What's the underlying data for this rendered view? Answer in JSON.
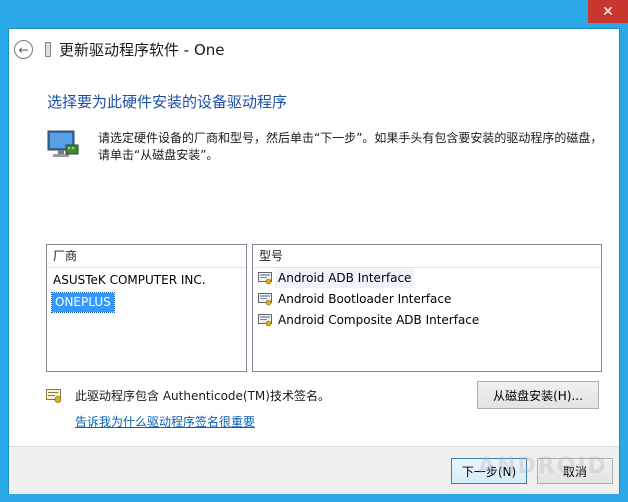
{
  "window": {
    "title": "更新驱动程序软件 - One",
    "close_glyph": "✕",
    "back_glyph": "←"
  },
  "heading": "选择要为此硬件安装的设备驱动程序",
  "description": "请选定硬件设备的厂商和型号，然后单击“下一步”。如果手头有包含要安装的驱动程序的磁盘，请单击“从磁盘安装”。",
  "manufacturers": {
    "header": "厂商",
    "items": [
      {
        "label": "ASUSTeK COMPUTER INC.",
        "selected": false
      },
      {
        "label": "ONEPLUS",
        "selected": true
      }
    ]
  },
  "models": {
    "header": "型号",
    "items": [
      {
        "label": "Android ADB Interface",
        "highlighted": true
      },
      {
        "label": "Android Bootloader Interface",
        "highlighted": false
      },
      {
        "label": "Android Composite ADB Interface",
        "highlighted": false
      }
    ]
  },
  "signature": {
    "text": "此驱动程序包含 Authenticode(TM)技术签名。",
    "link": "告诉我为什么驱动程序签名很重要"
  },
  "buttons": {
    "have_disk": "从磁盘安装(H)...",
    "next": "下一步(N)",
    "cancel": "取消"
  },
  "watermark": "ANDROID",
  "colors": {
    "title_bar": "#2aa8e8",
    "close_button": "#c7372f",
    "heading": "#1b4fa8",
    "selection": "#3399ff",
    "link": "#0a5fb5"
  }
}
